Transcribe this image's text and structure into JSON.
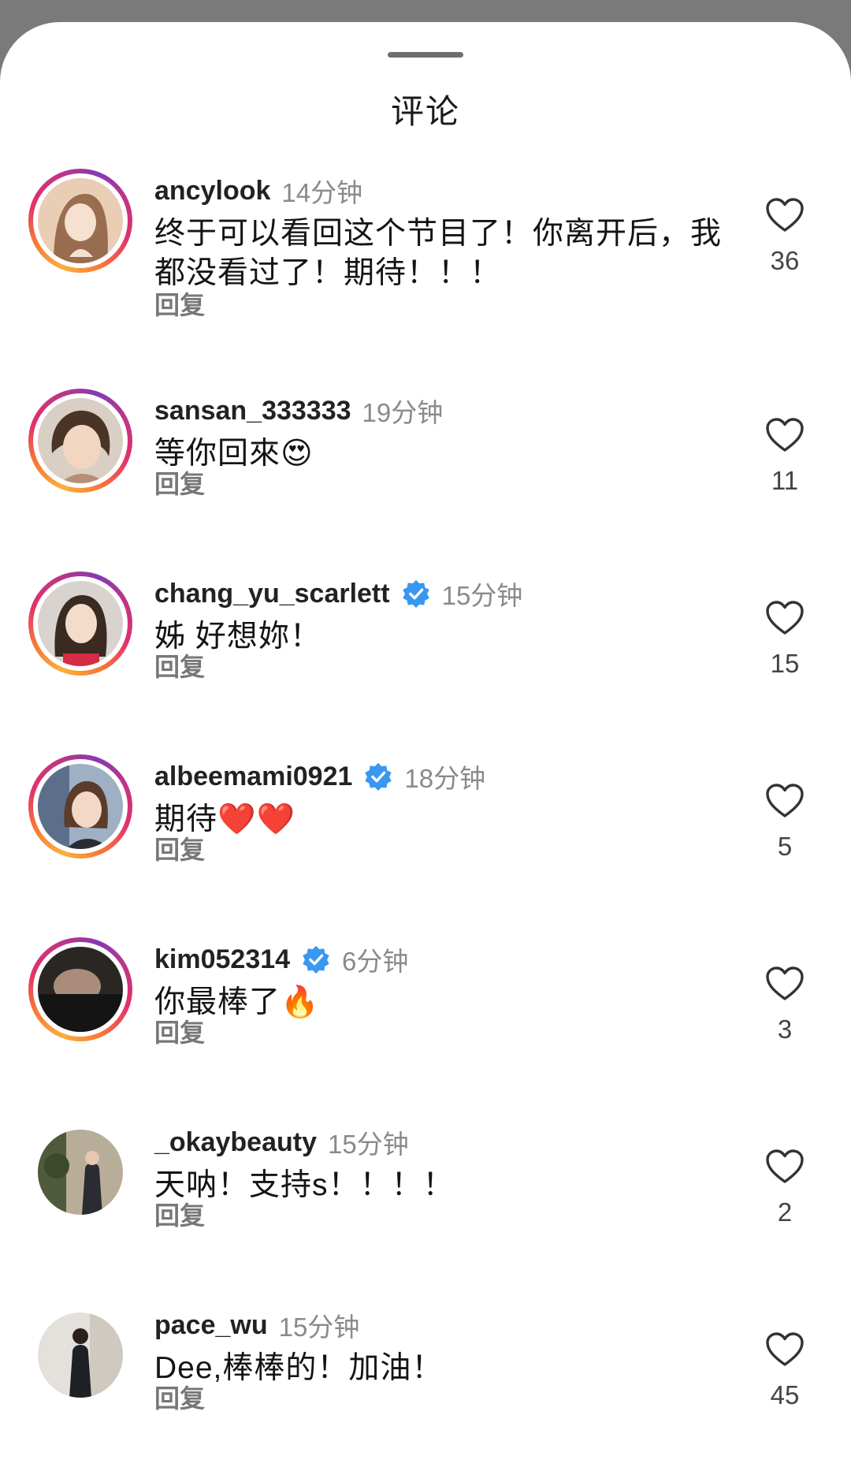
{
  "sheet": {
    "title": "评论"
  },
  "comments": [
    {
      "username": "ancylook",
      "time": "14分钟",
      "verified": false,
      "text": "终于可以看回这个节目了！你离开后，我都没看过了！期待！！！",
      "reply_label": "回复",
      "likes": "36",
      "story_ring": true
    },
    {
      "username": "sansan_333333",
      "time": "19分钟",
      "verified": false,
      "text": "等你回來😍",
      "reply_label": "回复",
      "likes": "11",
      "story_ring": true
    },
    {
      "username": "chang_yu_scarlett",
      "time": "15分钟",
      "verified": true,
      "text": "姊 好想妳！",
      "reply_label": "回复",
      "likes": "15",
      "story_ring": true
    },
    {
      "username": "albeemami0921",
      "time": "18分钟",
      "verified": true,
      "text": "期待❤️❤️",
      "reply_label": "回复",
      "likes": "5",
      "story_ring": true
    },
    {
      "username": "kim052314",
      "time": "6分钟",
      "verified": true,
      "text": "你最棒了🔥",
      "reply_label": "回复",
      "likes": "3",
      "story_ring": true
    },
    {
      "username": "_okaybeauty",
      "time": "15分钟",
      "verified": false,
      "text": "天呐！支持s！！！！",
      "reply_label": "回复",
      "likes": "2",
      "story_ring": false
    },
    {
      "username": "pace_wu",
      "time": "15分钟",
      "verified": false,
      "text": "Dee,棒棒的！加油！",
      "reply_label": "回复",
      "likes": "45",
      "story_ring": false
    }
  ],
  "icons": {
    "like": "heart-outline-icon",
    "verified": "verified-badge-icon"
  },
  "colors": {
    "verified": "#3897f0",
    "time": "#8a8a8a",
    "story_ring_start": "#fbb03b",
    "story_ring_end": "#c13584"
  }
}
